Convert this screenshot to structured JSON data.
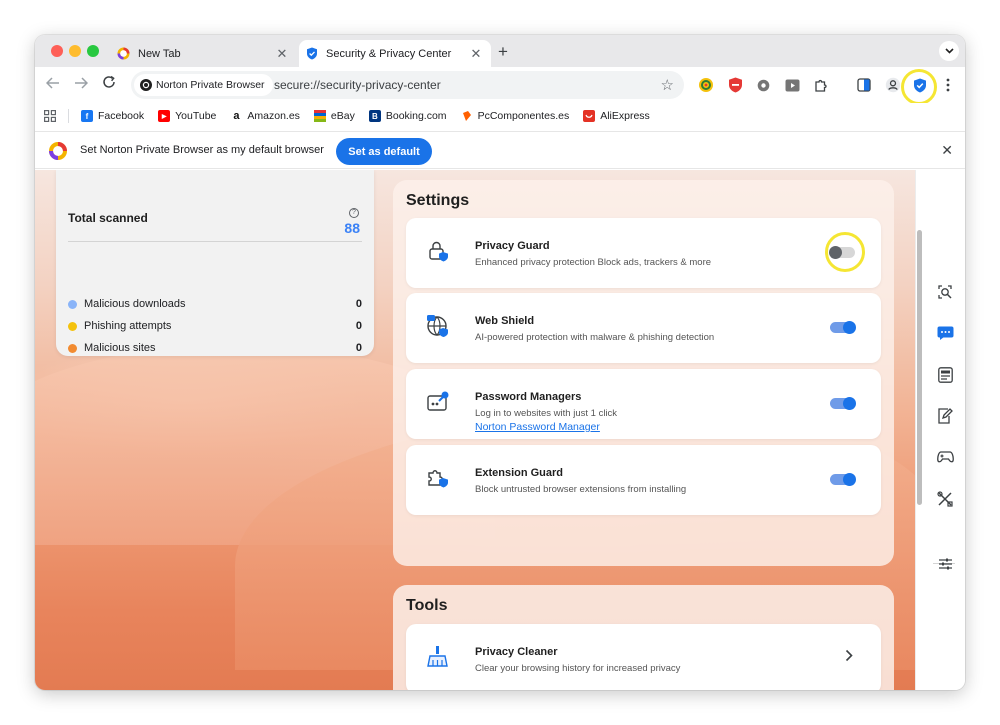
{
  "browser": {
    "tabs": [
      {
        "title": "New Tab",
        "icon": "norton-browser-icon",
        "active": false
      },
      {
        "title": "Security & Privacy Center",
        "icon": "shield-icon",
        "active": true
      }
    ],
    "new_tab_glyph": "+",
    "tab_close_glyph": "✕"
  },
  "toolbar": {
    "site_chip": "Norton Private Browser",
    "url": "secure://security-privacy-center",
    "extensions": [
      "vpn-icon",
      "adblock-icon",
      "settings-gear-icon",
      "video-icon",
      "extensions-puzzle-icon",
      "sidebar-icon",
      "profile-icon",
      "shield-check-icon",
      "more-icon"
    ]
  },
  "bookmarks": [
    {
      "label": "Facebook",
      "icon": "facebook-icon",
      "color": "#1877f2",
      "glyph": "f"
    },
    {
      "label": "YouTube",
      "icon": "youtube-icon",
      "color": "#ff0000",
      "glyph": "▶"
    },
    {
      "label": "Amazon.es",
      "icon": "amazon-icon",
      "color": "#ffffff",
      "glyph": "a"
    },
    {
      "label": "eBay",
      "icon": "ebay-icon",
      "color": "#e53238",
      "glyph": ""
    },
    {
      "label": "Booking.com",
      "icon": "booking-icon",
      "color": "#003580",
      "glyph": "B"
    },
    {
      "label": "PcComponentes.es",
      "icon": "pccomponentes-icon",
      "color": "#ff6000",
      "glyph": ""
    },
    {
      "label": "AliExpress",
      "icon": "aliexpress-icon",
      "color": "#e43225",
      "glyph": ""
    }
  ],
  "infobar": {
    "message": "Set Norton Private Browser as my default browser",
    "button": "Set as default",
    "close": "✕"
  },
  "stats": {
    "title": "Total scanned",
    "total": "88",
    "rows": [
      {
        "label": "Malicious downloads",
        "value": "0",
        "color": "#8ab4f8"
      },
      {
        "label": "Phishing attempts",
        "value": "0",
        "color": "#f4c20d"
      },
      {
        "label": "Malicious sites",
        "value": "0",
        "color": "#f28b30"
      }
    ]
  },
  "settings": {
    "title": "Settings",
    "items": [
      {
        "name": "Privacy Guard",
        "desc": "Enhanced privacy protection Block ads, trackers & more",
        "enabled": false,
        "icon": "privacy-guard-icon"
      },
      {
        "name": "Web Shield",
        "desc": "AI-powered protection with malware & phishing detection",
        "enabled": true,
        "icon": "web-shield-icon"
      },
      {
        "name": "Password Managers",
        "desc": "Log in to websites with just 1 click",
        "link": "Norton Password Manager",
        "enabled": true,
        "icon": "password-manager-icon"
      },
      {
        "name": "Extension Guard",
        "desc": "Block untrusted browser extensions from installing",
        "enabled": true,
        "icon": "extension-guard-icon"
      }
    ]
  },
  "tools": {
    "title": "Tools",
    "items": [
      {
        "name": "Privacy Cleaner",
        "desc": "Clear your browsing history for increased privacy",
        "icon": "broom-icon"
      }
    ]
  },
  "sidebar_icons": [
    "search-scan-icon",
    "chat-icon",
    "news-icon",
    "notes-icon",
    "gamepad-icon",
    "tools-icon",
    "sliders-icon"
  ],
  "colors": {
    "accent": "#1a73e8",
    "highlight": "#f5e633"
  }
}
